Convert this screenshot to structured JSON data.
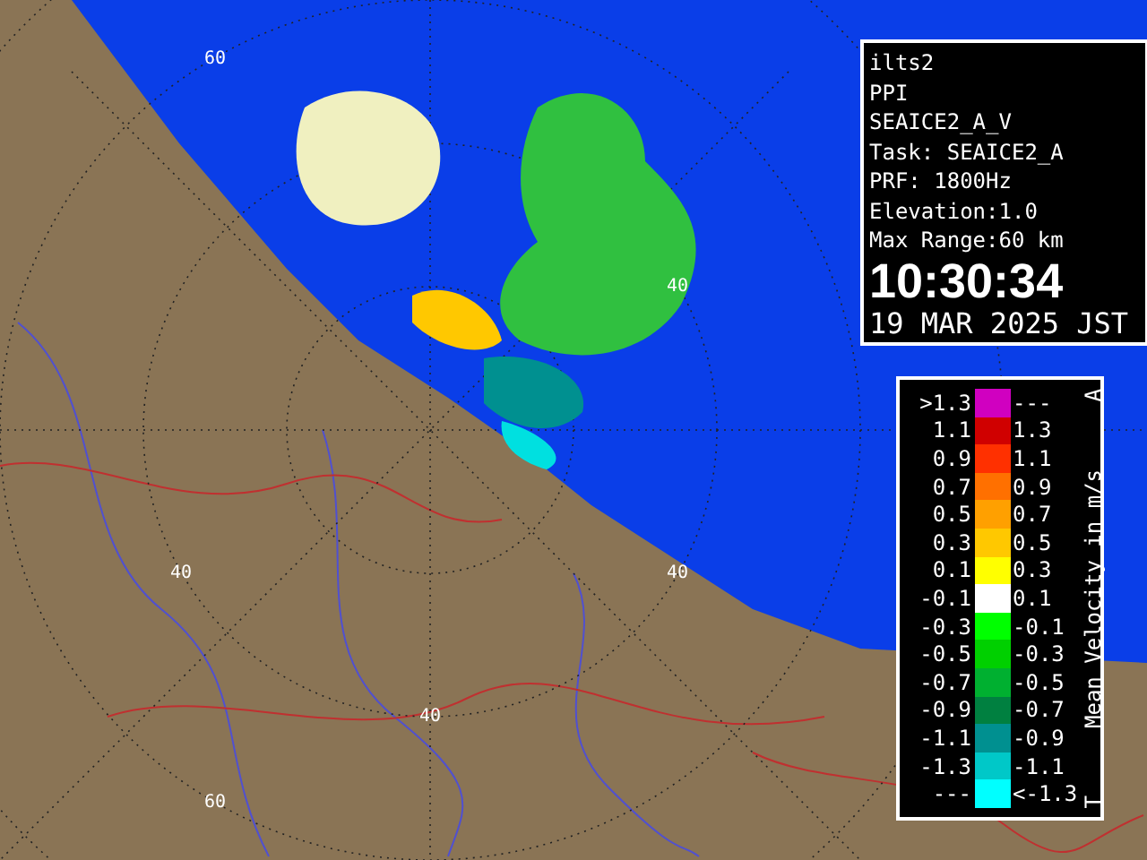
{
  "map": {
    "ring_labels": [
      "60",
      "40",
      "40",
      "40",
      "40",
      "60"
    ]
  },
  "info_panel": {
    "lines": [
      "ilts2",
      "PPI",
      "SEAICE2_A_V",
      "Task: SEAICE2_A",
      "PRF: 1800Hz",
      "Elevation:1.0",
      "Max Range:60 km"
    ],
    "time": "10:30:34",
    "date": "19 MAR 2025 JST"
  },
  "legend": {
    "title": "Mean Velocity in m/s",
    "top_mark": "A",
    "bottom_mark": "T",
    "rows": [
      {
        "low": ">1.3",
        "high": "---",
        "color": "#d000c0"
      },
      {
        "low": "1.1",
        "high": "1.3",
        "color": "#d00000"
      },
      {
        "low": "0.9",
        "high": "1.1",
        "color": "#ff3000"
      },
      {
        "low": "0.7",
        "high": "0.9",
        "color": "#ff7000"
      },
      {
        "low": "0.5",
        "high": "0.7",
        "color": "#ffa000"
      },
      {
        "low": "0.3",
        "high": "0.5",
        "color": "#ffc800"
      },
      {
        "low": "0.1",
        "high": "0.3",
        "color": "#ffff00"
      },
      {
        "low": "-0.1",
        "high": "0.1",
        "color": "#ffffff"
      },
      {
        "low": "-0.3",
        "high": "-0.1",
        "color": "#00ff00"
      },
      {
        "low": "-0.5",
        "high": "-0.3",
        "color": "#00d000"
      },
      {
        "low": "-0.7",
        "high": "-0.5",
        "color": "#00b030"
      },
      {
        "low": "-0.9",
        "high": "-0.7",
        "color": "#008040"
      },
      {
        "low": "-1.1",
        "high": "-0.9",
        "color": "#009090"
      },
      {
        "low": "-1.3",
        "high": "-1.1",
        "color": "#00c8c8"
      },
      {
        "low": "---",
        "high": "<-1.3",
        "color": "#00ffff"
      }
    ]
  }
}
